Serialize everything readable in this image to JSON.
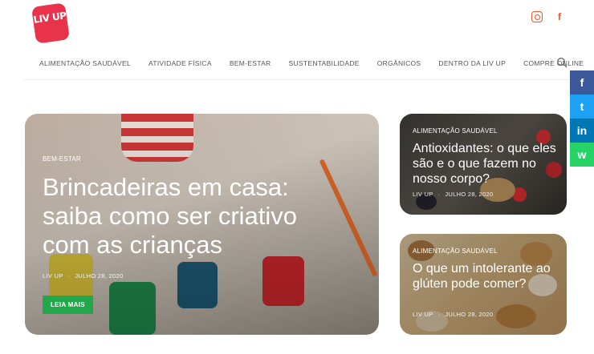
{
  "brand": {
    "logo_text": "LIV UP",
    "accent": "#e8334a"
  },
  "social_top": [
    {
      "icon": "instagram-icon"
    },
    {
      "icon": "facebook-icon",
      "glyph": "f"
    }
  ],
  "nav": {
    "items": [
      "ALIMENTAÇÃO SAUDÁVEL",
      "ATIVIDADE FÍSICA",
      "BEM-ESTAR",
      "SUSTENTABILIDADE",
      "ORGÂNICOS",
      "DENTRO DA LIV UP",
      "COMPRE ONLINE"
    ]
  },
  "share": {
    "facebook": "f",
    "twitter": "t",
    "linkedin": "in",
    "whatsapp": "w"
  },
  "featured": {
    "category": "BEM-ESTAR",
    "title": "Brincadeiras em casa: saiba como ser criativo com as crianças",
    "author": "LIV UP",
    "date": "JULHO 28, 2020",
    "button": "LEIA MAIS"
  },
  "side_posts": [
    {
      "category": "ALIMENTAÇÃO SAUDÁVEL",
      "title": "Antioxidantes: o que eles são e o que fazem no nosso corpo?",
      "author": "LIV UP",
      "date": "JULHO 28, 2020"
    },
    {
      "category": "ALIMENTAÇÃO SAUDÁVEL",
      "title": "O que um intolerante ao glúten pode comer?",
      "author": "LIV UP",
      "date": "JULHO 28, 2020"
    }
  ]
}
